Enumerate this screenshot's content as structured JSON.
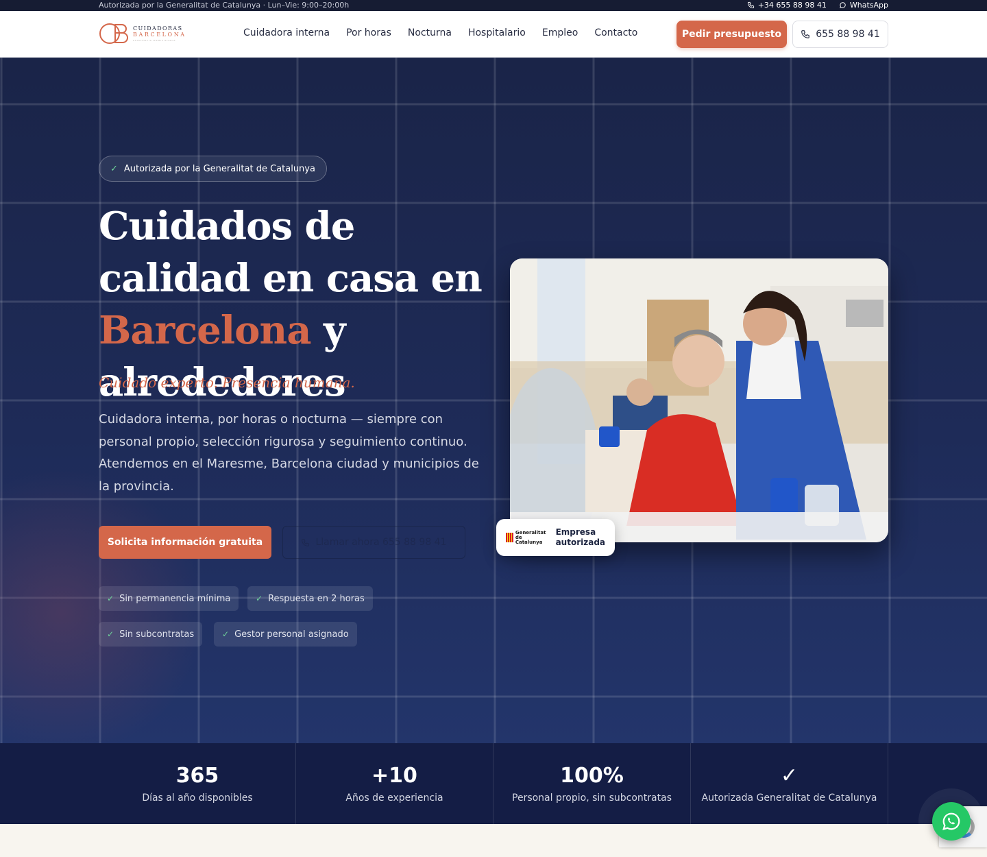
{
  "topbar": {
    "left_text": "Autorizada por la Generalitat de Catalunya · Lun–Vie: 9:00–20:00h",
    "phone": "+34 655 88 98 41",
    "whatsapp": "WhatsApp"
  },
  "header": {
    "logo": {
      "line1": "CUIDADORAS",
      "line2": "BARCELONA",
      "line3": "ASISTENCIA DOMICILIARIA"
    },
    "nav": [
      "Cuidadora interna",
      "Por horas",
      "Nocturna",
      "Hospitalario",
      "Empleo",
      "Contacto"
    ],
    "quote_button": "Pedir presupuesto",
    "phone_button": "655 88 98 41"
  },
  "hero": {
    "badge": "Autorizada por la Generalitat de Catalunya",
    "title_part1": "Cuidados de calidad en casa en ",
    "title_accent": "Barcelona",
    "title_part2": " y alrededores",
    "tagline": "Cuidado experto. Presencia humana.",
    "lead": "Cuidadora interna, por horas o nocturna — siempre con personal propio, selección rigurosa y seguimiento continuo. Atendemos en el Maresme, Barcelona ciudad y municipios de la provincia.",
    "cta_primary": "Solicita información gratuita",
    "cta_secondary": "Llamar ahora 655 88 98 41",
    "pills": [
      "Sin permanencia mínima",
      "Respuesta en 2 horas",
      "Sin subcontratas",
      "Gestor personal asignado"
    ],
    "auth_card": {
      "logo_line1": "Generalitat",
      "logo_line2": "de Catalunya",
      "text_line1": "Empresa",
      "text_line2": "autorizada"
    }
  },
  "stats": [
    {
      "value": "365",
      "label": "Días al año disponibles"
    },
    {
      "value": "+10",
      "label": "Años de experiencia"
    },
    {
      "value": "100%",
      "label": "Personal propio, sin subcontratas"
    },
    {
      "value": "✓",
      "label": "Autorizada Generalitat de Catalunya"
    }
  ],
  "colors": {
    "accent": "#d4674a",
    "navy": "#1a2448",
    "check": "#6fd39a",
    "whatsapp": "#25c866"
  }
}
